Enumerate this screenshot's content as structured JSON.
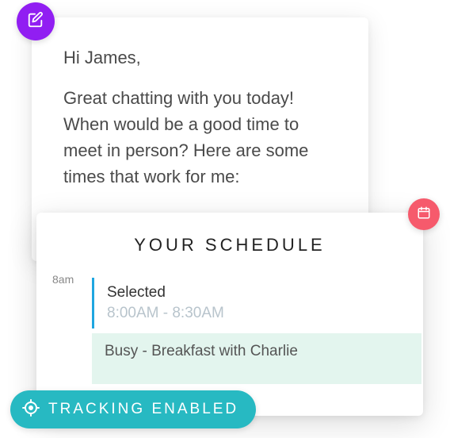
{
  "message": {
    "greeting": "Hi James,",
    "body": "Great chatting with you today! When would be a good time to meet in person? Here are some times that work for me:"
  },
  "schedule": {
    "header": "YOUR SCHEDULE",
    "time_marker": "8am",
    "selected": {
      "label": "Selected",
      "range": "8:00AM - 8:30AM"
    },
    "busy": {
      "label": "Busy - Breakfast with Charlie"
    }
  },
  "tracking": {
    "label": "TRACKING ENABLED"
  },
  "icons": {
    "compose": "compose-icon",
    "calendar": "calendar-icon",
    "target": "target-icon"
  },
  "colors": {
    "compose_badge": "#911ef2",
    "calendar_badge": "#f65a6c",
    "tracking_pill": "#27b9c2",
    "selected_accent": "#1fa6e0",
    "busy_bg": "#e3f5ee"
  }
}
